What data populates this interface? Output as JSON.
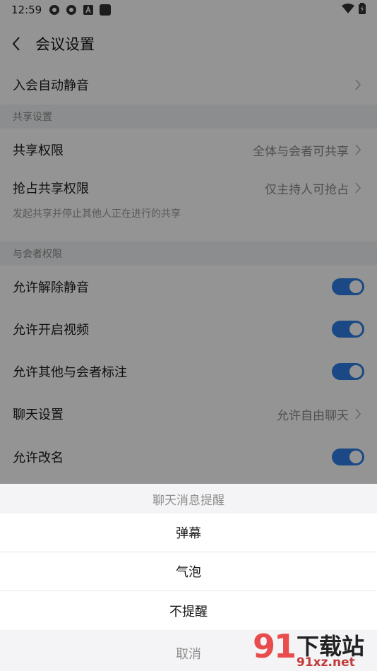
{
  "status_bar": {
    "time": "12:59"
  },
  "header": {
    "title": "会议设置"
  },
  "rows": {
    "auto_mute": "入会自动静音",
    "share_section": "共享设置",
    "share_permission": {
      "label": "共享权限",
      "value": "全体与会者可共享"
    },
    "grab_share": {
      "label": "抢占共享权限",
      "value": "仅主持人可抢占"
    },
    "grab_hint": "发起共享并停止其他人正在进行的共享",
    "attendee_section": "与会者权限",
    "allow_unmute": "允许解除静音",
    "allow_video": "允许开启视频",
    "allow_annotate": "允许其他与会者标注",
    "chat_settings": {
      "label": "聊天设置",
      "value": "允许自由聊天"
    },
    "allow_rename": "允许改名"
  },
  "toggles": {
    "allow_unmute": true,
    "allow_video": true,
    "allow_annotate": true,
    "allow_rename": true
  },
  "sheet": {
    "title": "聊天消息提醒",
    "options": [
      "弹幕",
      "气泡",
      "不提醒"
    ],
    "cancel": "取消"
  },
  "watermark": {
    "brand": "下载站",
    "url": "91xz.net"
  },
  "colors": {
    "accent": "#2f7fe6",
    "watermark_red": "#e94c4c"
  }
}
